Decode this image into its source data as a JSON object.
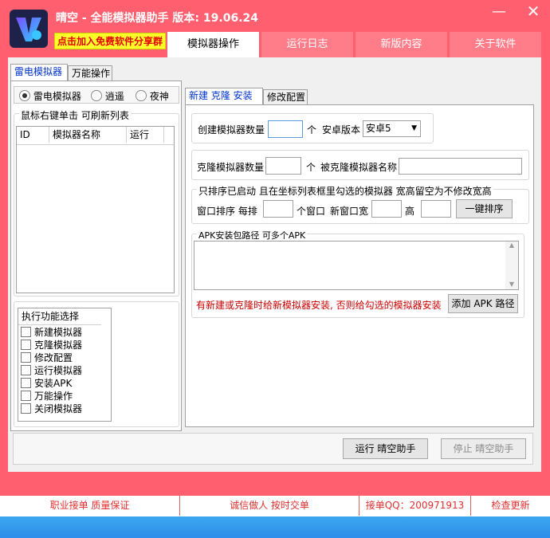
{
  "window": {
    "title": "晴空 - 全能模拟器助手  版本: 19.06.24",
    "promo": "点击加入免费软件分享群",
    "minimize": "—",
    "close": "✕"
  },
  "top_tabs": [
    {
      "label": "模拟器操作"
    },
    {
      "label": "运行日志"
    },
    {
      "label": "新版内容"
    },
    {
      "label": "关于软件"
    }
  ],
  "left_tabs": [
    "雷电模拟器",
    "万能操作"
  ],
  "emulator_radios": [
    {
      "label": "雷电模拟器",
      "checked": true
    },
    {
      "label": "逍遥",
      "checked": false
    },
    {
      "label": "夜神",
      "checked": false
    }
  ],
  "list_hint": "鼠标右键单击 可刷新列表",
  "table": {
    "columns": [
      "ID",
      "模拟器名称",
      "运行"
    ],
    "rows": []
  },
  "functions": {
    "title": "执行功能选择",
    "items": [
      "新建模拟器",
      "克隆模拟器",
      "修改配置",
      "运行模拟器",
      "安装APK",
      "万能操作",
      "关闭模拟器"
    ]
  },
  "right_tabs": [
    "新建 克隆 安装",
    "修改配置"
  ],
  "create": {
    "label": "创建模拟器数量",
    "unit": "个",
    "android_label": "安卓版本",
    "android_value": "安卓5",
    "count_value": ""
  },
  "clone": {
    "label": "克隆模拟器数量",
    "unit": "个",
    "source_label": "被克隆模拟器名称",
    "count_value": "",
    "source_value": ""
  },
  "arrange": {
    "note": "只排序已启动 且在坐标列表框里勾选的模拟器 宽高留空为不修改宽高",
    "label1": "窗口排序 每排",
    "label2": "个窗口",
    "label3": "新窗口宽",
    "label4": "高",
    "button": "一键排序"
  },
  "apk": {
    "label": "APK安装包路径 可多个APK",
    "note": "有新建或克隆时给新模拟器安装, 否则给勾选的模拟器安装",
    "button": "添加 APK 路径"
  },
  "actions": {
    "run": "运行 晴空助手",
    "stop": "停止 晴空助手"
  },
  "footer": [
    "职业接单 质量保证",
    "诚信做人 按时交单",
    "接单QQ：200971913",
    "检查更新"
  ],
  "colors": {
    "brand": "#ff5f6e",
    "promo_bg": "#ffff2a",
    "note_red": "#cc0000"
  }
}
